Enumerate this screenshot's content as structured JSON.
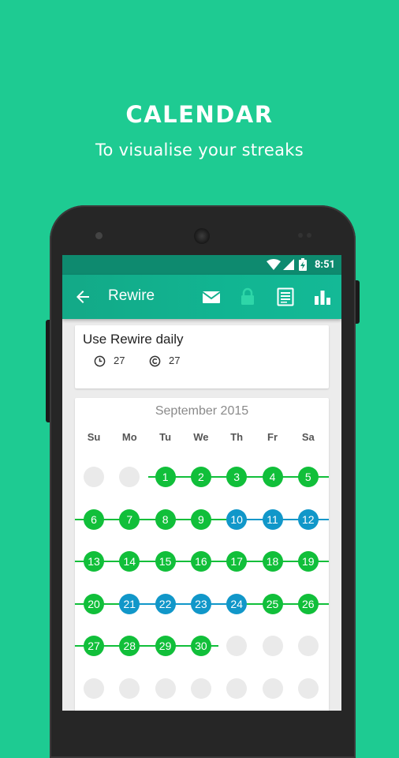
{
  "promo": {
    "title": "CALENDAR",
    "subtitle": "To visualise your streaks"
  },
  "status_bar": {
    "time": "8:51"
  },
  "app_bar": {
    "title": "Rewire",
    "actions": [
      "mail-icon",
      "lock-icon",
      "notes-icon",
      "stats-icon"
    ]
  },
  "habit": {
    "name": "Use Rewire daily",
    "stat_1": "27",
    "stat_2": "27"
  },
  "calendar": {
    "month": "September 2015",
    "weekdays": [
      "Su",
      "Mo",
      "Tu",
      "We",
      "Th",
      "Fr",
      "Sa"
    ],
    "colors": {
      "green": "#11bf3a",
      "blue": "#1197c9",
      "empty": "#eaeaea"
    },
    "weeks": [
      [
        null,
        null,
        {
          "d": "1",
          "c": "green"
        },
        {
          "d": "2",
          "c": "green"
        },
        {
          "d": "3",
          "c": "green"
        },
        {
          "d": "4",
          "c": "green"
        },
        {
          "d": "5",
          "c": "green"
        }
      ],
      [
        {
          "d": "6",
          "c": "green"
        },
        {
          "d": "7",
          "c": "green"
        },
        {
          "d": "8",
          "c": "green"
        },
        {
          "d": "9",
          "c": "green"
        },
        {
          "d": "10",
          "c": "blue"
        },
        {
          "d": "11",
          "c": "blue"
        },
        {
          "d": "12",
          "c": "blue"
        }
      ],
      [
        {
          "d": "13",
          "c": "green"
        },
        {
          "d": "14",
          "c": "green"
        },
        {
          "d": "15",
          "c": "green"
        },
        {
          "d": "16",
          "c": "green"
        },
        {
          "d": "17",
          "c": "green"
        },
        {
          "d": "18",
          "c": "green"
        },
        {
          "d": "19",
          "c": "green"
        }
      ],
      [
        {
          "d": "20",
          "c": "green"
        },
        {
          "d": "21",
          "c": "blue"
        },
        {
          "d": "22",
          "c": "blue"
        },
        {
          "d": "23",
          "c": "blue"
        },
        {
          "d": "24",
          "c": "blue"
        },
        {
          "d": "25",
          "c": "green"
        },
        {
          "d": "26",
          "c": "green"
        }
      ],
      [
        {
          "d": "27",
          "c": "green"
        },
        {
          "d": "28",
          "c": "green"
        },
        {
          "d": "29",
          "c": "green"
        },
        {
          "d": "30",
          "c": "green"
        },
        null,
        null,
        null
      ],
      [
        null,
        null,
        null,
        null,
        null,
        null,
        null
      ]
    ],
    "streak_segments": [
      {
        "week": 0,
        "from_col": 2,
        "to_col": 6,
        "c": "green"
      },
      {
        "week": 1,
        "from_col": 0,
        "to_col": 4,
        "c": "green"
      },
      {
        "week": 1,
        "from_col": 4,
        "to_col": 6,
        "c": "blue"
      },
      {
        "week": 2,
        "from_col": 0,
        "to_col": 6,
        "c": "green"
      },
      {
        "week": 3,
        "from_col": 0,
        "to_col": 1,
        "c": "green"
      },
      {
        "week": 3,
        "from_col": 1,
        "to_col": 4,
        "c": "blue"
      },
      {
        "week": 3,
        "from_col": 4,
        "to_col": 6,
        "c": "green"
      },
      {
        "week": 4,
        "from_col": 0,
        "to_col": 3,
        "c": "green"
      }
    ]
  }
}
